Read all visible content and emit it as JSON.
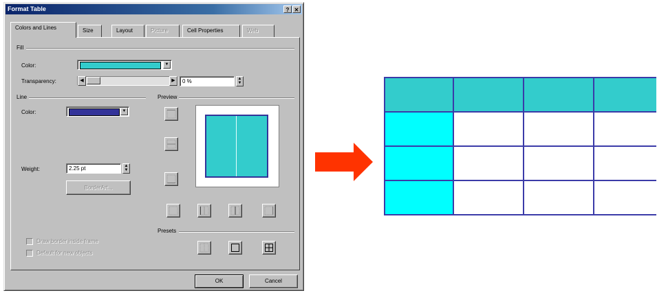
{
  "dialog": {
    "title": "Format Table",
    "help_btn": "?",
    "close_btn": "✕",
    "tabs": [
      {
        "label": "Colors and Lines",
        "active": true,
        "disabled": false
      },
      {
        "label": "Size",
        "active": false,
        "disabled": false
      },
      {
        "label": "Layout",
        "active": false,
        "disabled": false
      },
      {
        "label": "Picture",
        "active": false,
        "disabled": true
      },
      {
        "label": "Cell Properties",
        "active": false,
        "disabled": false
      },
      {
        "label": "Web",
        "active": false,
        "disabled": true
      }
    ],
    "fill": {
      "group_label": "Fill",
      "color_label": "Color:",
      "color_value": "#33cccc",
      "transparency_label": "Transparency:",
      "transparency_value": "0 %",
      "transparency_level": 0
    },
    "line": {
      "group_label": "Line",
      "color_label": "Color:",
      "color_value": "#333399",
      "weight_label": "Weight:",
      "weight_value": "2.25 pt",
      "border_art_label": "BorderArt..."
    },
    "preview": {
      "group_label": "Preview",
      "fill_color": "#33cccc",
      "border_color": "#333399"
    },
    "presets_label": "Presets",
    "draw_border_inside_frame": "Draw border inside frame",
    "default_for_new_objects": "Default for new objects",
    "ok_label": "OK",
    "cancel_label": "Cancel"
  },
  "arrow_color": "#ff3300",
  "result_table": {
    "border_color": "#3a3aa8",
    "header_fill": "#33cccc",
    "first_col_fill": "#00ffff",
    "body_fill": "#ffffff"
  }
}
